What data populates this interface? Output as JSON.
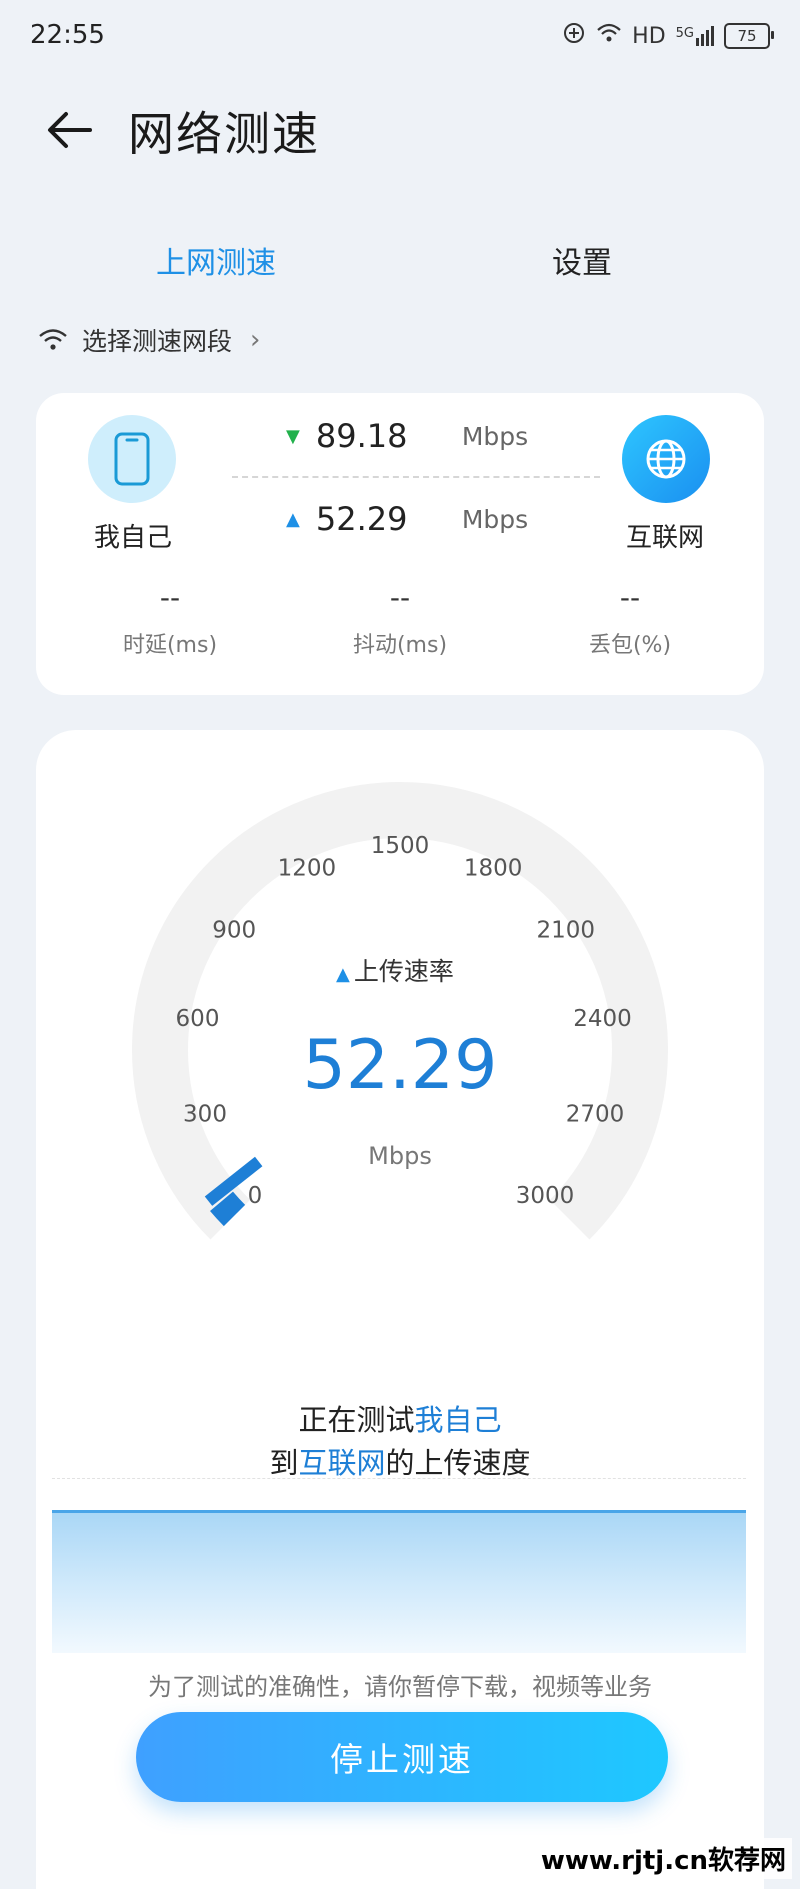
{
  "status_bar": {
    "time": "22:55",
    "network": "HD",
    "signal": "5G",
    "battery": "75"
  },
  "header": {
    "title": "网络测速"
  },
  "tabs": [
    {
      "label": "上网测速",
      "active": true
    },
    {
      "label": "设置",
      "active": false
    }
  ],
  "segment": {
    "label": "选择测速网段"
  },
  "summary": {
    "self_label": "我自己",
    "internet_label": "互联网",
    "download": {
      "value": "89.18",
      "unit": "Mbps"
    },
    "upload": {
      "value": "52.29",
      "unit": "Mbps"
    },
    "metrics": [
      {
        "value": "--",
        "label": "时延(ms)"
      },
      {
        "value": "--",
        "label": "抖动(ms)"
      },
      {
        "value": "--",
        "label": "丢包(%)"
      }
    ]
  },
  "gauge": {
    "caption": "上传速率",
    "value": "52.29",
    "value_number": 52.29,
    "max": 3000,
    "unit": "Mbps",
    "ticks": [
      "0",
      "300",
      "600",
      "900",
      "1200",
      "1500",
      "1800",
      "2100",
      "2400",
      "2700",
      "3000"
    ]
  },
  "testing": {
    "line1_prefix": "正在测试",
    "line1_highlight": "我自己",
    "line2_prefix": "到",
    "line2_highlight": "互联网",
    "line2_suffix": "的上传速度"
  },
  "tip": "为了测试的准确性，请你暂停下载，视频等业务",
  "stop_button": "停止测速",
  "watermark": "www.rjtj.cn软荐网",
  "colors": {
    "accent": "#1e7fd6",
    "download_arrow": "#22b14c",
    "upload_arrow": "#1e90e6"
  }
}
